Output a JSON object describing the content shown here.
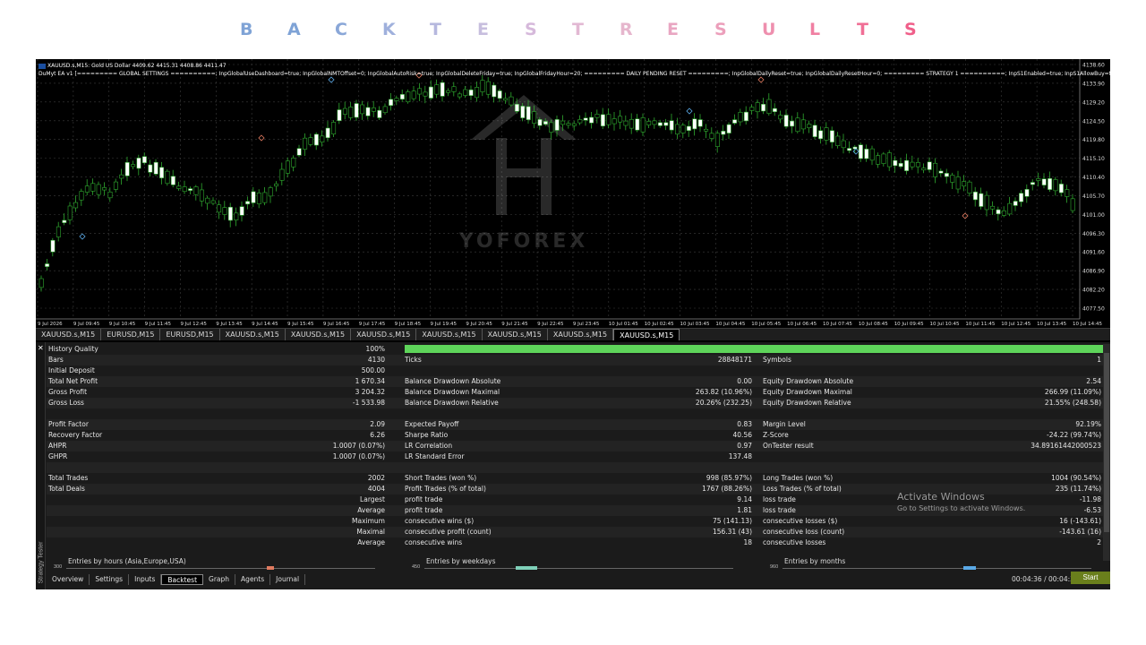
{
  "page": {
    "title_letters": [
      "B",
      "A",
      "C",
      "K",
      "T",
      "E",
      "S",
      "T",
      "R",
      "E",
      "S",
      "U",
      "L",
      "T",
      "S"
    ],
    "title_colors": [
      "#7fa3d6",
      "#7fa3d6",
      "#8aa7d8",
      "#9fb0dc",
      "#b6b8de",
      "#c7bede",
      "#d6b9db",
      "#e2b8d3",
      "#e6b6cd",
      "#e9a6c2",
      "#ec9fbb",
      "#ee8fae",
      "#f07fa2",
      "#f06f96",
      "#f05f8a"
    ]
  },
  "chart": {
    "symbol_header": "XAUUSD.s,M15:  Gold US Dollar  4409.62 4415.31 4408.86 4411.47",
    "ea_header": "DuMyt EA v1 [========= GLOBAL SETTINGS ==========; InpGlobalUseDashboard=true; InpGlobalNMTOffset=0; InpGlobalAutoRisk=true; InpGlobalDeleteFriday=true; InpGlobalFridayHour=20; ========= DAILY PENDING RESET =========; InpGlobalDailyReset=true; InpGlobalDailyResetHour=0; ========= STRATEGY 1 ==========; InpS1Enabled=true; InpS1AllowBuy=true; InpS1AllowSell=true; Inp",
    "watermark_text": "YOFOREX",
    "price_labels": [
      "4138.60",
      "4133.90",
      "4129.20",
      "4124.50",
      "4119.80",
      "4115.10",
      "4110.40",
      "4105.70",
      "4101.00",
      "4096.30",
      "4091.60",
      "4086.90",
      "4082.20",
      "4077.50"
    ],
    "time_labels": [
      "9 Jul 2026",
      "9 Jul 09:45",
      "9 Jul 10:45",
      "9 Jul 11:45",
      "9 Jul 12:45",
      "9 Jul 13:45",
      "9 Jul 14:45",
      "9 Jul 15:45",
      "9 Jul 16:45",
      "9 Jul 17:45",
      "9 Jul 18:45",
      "9 Jul 19:45",
      "9 Jul 20:45",
      "9 Jul 21:45",
      "9 Jul 22:45",
      "9 Jul 23:45",
      "10 Jul 01:45",
      "10 Jul 02:45",
      "10 Jul 03:45",
      "10 Jul 04:45",
      "10 Jul 05:45",
      "10 Jul 06:45",
      "10 Jul 07:45",
      "10 Jul 08:45",
      "10 Jul 09:45",
      "10 Jul 10:45",
      "10 Jul 11:45",
      "10 Jul 12:45",
      "10 Jul 13:45",
      "10 Jul 14:45"
    ]
  },
  "tabs": [
    "XAUUSD.s,M15",
    "EURUSD,M15",
    "EURUSD,M15",
    "XAUUSD.s,M15",
    "XAUUSD.s,M15",
    "XAUUSD.s,M15",
    "XAUUSD.s,M15",
    "XAUUSD.s,M15",
    "XAUUSD.s,M15",
    "XAUUSD.s,M15"
  ],
  "report": {
    "history_quality_label": "History Quality",
    "history_quality_value": "100%",
    "history_quality_fraction": 1.0,
    "rows": [
      [
        "Bars",
        "4130",
        "Ticks",
        "28848171",
        "Symbols",
        "1"
      ],
      [
        "Initial Deposit",
        "500.00",
        "",
        "",
        "",
        ""
      ],
      [
        "Total Net Profit",
        "1 670.34",
        "Balance Drawdown Absolute",
        "0.00",
        "Equity Drawdown Absolute",
        "2.54"
      ],
      [
        "Gross Profit",
        "3 204.32",
        "Balance Drawdown Maximal",
        "263.82 (10.96%)",
        "Equity Drawdown Maximal",
        "266.99 (11.09%)"
      ],
      [
        "Gross Loss",
        "-1 533.98",
        "Balance Drawdown Relative",
        "20.26% (232.25)",
        "Equity Drawdown Relative",
        "21.55% (248.58)"
      ],
      [
        "",
        "",
        "",
        "",
        "",
        ""
      ],
      [
        "Profit Factor",
        "2.09",
        "Expected Payoff",
        "0.83",
        "Margin Level",
        "92.19%"
      ],
      [
        "Recovery Factor",
        "6.26",
        "Sharpe Ratio",
        "40.56",
        "Z-Score",
        "-24.22 (99.74%)"
      ],
      [
        "AHPR",
        "1.0007 (0.07%)",
        "LR Correlation",
        "0.97",
        "OnTester result",
        "34.89161442000523"
      ],
      [
        "GHPR",
        "1.0007 (0.07%)",
        "LR Standard Error",
        "137.48",
        "",
        ""
      ],
      [
        "",
        "",
        "",
        "",
        "",
        ""
      ],
      [
        "Total Trades",
        "2002",
        "Short Trades (won %)",
        "998 (85.97%)",
        "Long Trades (won %)",
        "1004 (90.54%)"
      ],
      [
        "Total Deals",
        "4004",
        "Profit Trades (% of total)",
        "1767 (88.26%)",
        "Loss Trades (% of total)",
        "235 (11.74%)"
      ],
      [
        "",
        "Largest",
        "profit trade",
        "9.14",
        "loss trade",
        "-11.98"
      ],
      [
        "",
        "Average",
        "profit trade",
        "1.81",
        "loss trade",
        "-6.53"
      ],
      [
        "",
        "Maximum",
        "consecutive wins ($)",
        "75 (141.13)",
        "consecutive losses ($)",
        "16 (-143.61)"
      ],
      [
        "",
        "Maximal",
        "consecutive profit (count)",
        "156.31 (43)",
        "consecutive loss (count)",
        "-143.61 (16)"
      ],
      [
        "",
        "Average",
        "consecutive wins",
        "18",
        "consecutive losses",
        "2"
      ]
    ]
  },
  "entries": [
    {
      "label": "Entries by hours (Asia,Europe,USA)",
      "axis_max": "300",
      "color": "#e07a5f"
    },
    {
      "label": "Entries by weekdays",
      "axis_max": "450",
      "color": "#7fd1b9"
    },
    {
      "label": "Entries by months",
      "axis_max": "960",
      "color": "#5aa9e6"
    }
  ],
  "bottom_tabs": [
    "Overview",
    "Settings",
    "Inputs",
    "Backtest",
    "Graph",
    "Agents",
    "Journal"
  ],
  "active_bottom_tab": "Backtest",
  "side_label": "Strategy Tester",
  "close_glyph": "✕",
  "timer": "00:04:36 / 00:04:36",
  "start_label": "Start",
  "activate_windows": {
    "title": "Activate Windows",
    "subtitle": "Go to Settings to activate Windows."
  }
}
